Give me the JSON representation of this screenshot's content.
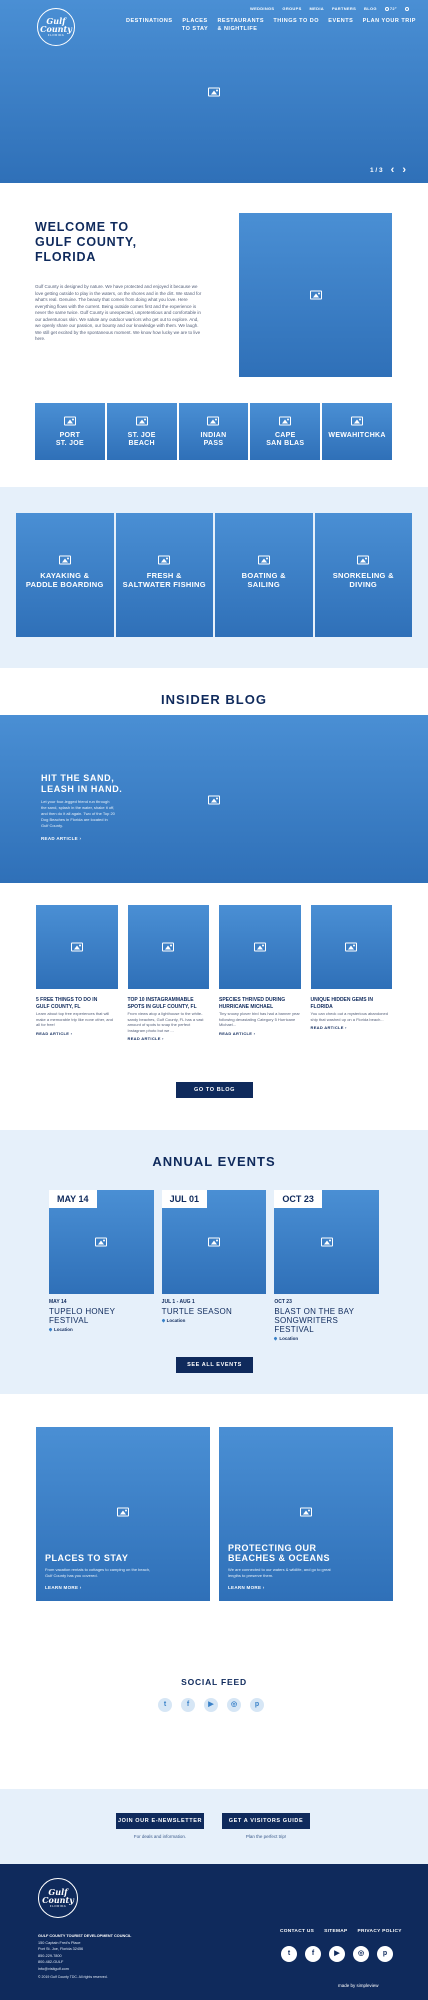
{
  "header": {
    "logo_line1": "Gulf",
    "logo_line2": "County",
    "logo_sub": "FLORIDA",
    "top_links": [
      "WEDDINGS",
      "GROUPS",
      "MEDIA",
      "PARTNERS",
      "BLOG"
    ],
    "weather": "72°",
    "nav": [
      {
        "line1": "DESTINATIONS",
        "line2": ""
      },
      {
        "line1": "PLACES",
        "line2": "TO STAY"
      },
      {
        "line1": "RESTAURANTS",
        "line2": "& NIGHTLIFE"
      },
      {
        "line1": "THINGS TO DO",
        "line2": ""
      },
      {
        "line1": "EVENTS",
        "line2": ""
      },
      {
        "line1": "PLAN YOUR TRIP",
        "line2": ""
      }
    ],
    "slide_counter": "1 / 3"
  },
  "welcome": {
    "title_line1": "WELCOME TO",
    "title_line2": "GULF COUNTY,",
    "title_line3": "FLORIDA",
    "body": "Gulf County is designed by nature. We have protected and enjoyed it because we love getting outside to play in the waters, on the shores and in the dirt. We stand for what's real. Genuine. The beauty that comes from doing what you love. Here everything flows with the current. Being outside comes first and the experience is never the same twice. Gulf County is unexpected, unpretentious and comfortable in our adventurous skin. We salute any outdoor warriors who get out to explore. And, we openly share our passion, our bounty and our knowledge with them. We laugh. We still get excited by the spontaneous moment. We know how lucky we are to live here."
  },
  "destinations": [
    {
      "line1": "PORT",
      "line2": "ST. JOE"
    },
    {
      "line1": "ST. JOE",
      "line2": "BEACH"
    },
    {
      "line1": "INDIAN",
      "line2": "PASS"
    },
    {
      "line1": "CAPE",
      "line2": "SAN BLAS"
    },
    {
      "line1": "WEWAHITCHKA",
      "line2": ""
    }
  ],
  "activities": [
    {
      "line1": "KAYAKING &",
      "line2": "PADDLE BOARDING"
    },
    {
      "line1": "FRESH &",
      "line2": "SALTWATER FISHING"
    },
    {
      "line1": "BOATING &",
      "line2": "SAILING"
    },
    {
      "line1": "SNORKELING &",
      "line2": "DIVING"
    }
  ],
  "blog": {
    "heading": "INSIDER BLOG",
    "feature": {
      "title_line1": "HIT THE SAND,",
      "title_line2": "LEASH IN HAND.",
      "body": "Let your four-legged friend run through the sand, splash in the water, shake it off, and then do it all again. Two of the Top 20 Dog Beaches in Florida are located in Gulf County.",
      "link": "READ ARTICLE ›"
    },
    "posts": [
      {
        "title_line1": "5 FREE THINGS TO DO IN",
        "title_line2": "GULF COUNTY, FL",
        "body": "Learn about top free experiences that will make a memorable trip like none other, and all for free!",
        "link": "READ ARTICLE ›"
      },
      {
        "title_line1": "TOP 10 INSTAGRAMMABLE",
        "title_line2": "SPOTS IN GULF COUNTY, FL",
        "body": "From views atop a lighthouse to the white-sandy beaches, Gulf County, FL has a vast amount of spots to snap the perfect Instagram photo but we ...",
        "link": "READ ARTICLE ›"
      },
      {
        "title_line1": "SPECIES THRIVED DURING",
        "title_line2": "HURRICANE MICHAEL",
        "body": "Tiny snowy plover bird has had a banner year following devastating Category 5 Hurricane Michael...",
        "link": "READ ARTICLE ›"
      },
      {
        "title_line1": "UNIQUE HIDDEN GEMS IN",
        "title_line2": "FLORIDA",
        "body": "You can check out a mysterious abandoned ship that washed up on a Florida beach...",
        "link": "READ ARTICLE ›"
      }
    ],
    "button": "GO TO BLOG"
  },
  "events": {
    "heading": "ANNUAL EVENTS",
    "items": [
      {
        "badge": "MAY 14",
        "date": "MAY 14",
        "name_line1": "TUPELO HONEY FESTIVAL",
        "name_line2": "",
        "location": "Location"
      },
      {
        "badge": "JUL 01",
        "date": "JUL 1 - AUG 1",
        "name_line1": "TURTLE SEASON",
        "name_line2": "",
        "location": "Location"
      },
      {
        "badge": "OCT 23",
        "date": "OCT 23",
        "name_line1": "BLAST ON THE BAY",
        "name_line2": "SONGWRITERS FESTIVAL",
        "location": "Location"
      }
    ],
    "button": "SEE ALL EVENTS"
  },
  "promos": [
    {
      "title_line1": "PLACES TO STAY",
      "title_line2": "",
      "body": "From vacation rentals to cottages to camping on the beach, Gulf County has you covered.",
      "link": "LEARN MORE ›"
    },
    {
      "title_line1": "PROTECTING OUR",
      "title_line2": "BEACHES & OCEANS",
      "body": "We are connected to our waters & wildlife, and go to great lengths to preserve them.",
      "link": "LEARN MORE ›"
    }
  ],
  "social": {
    "heading": "SOCIAL FEED",
    "icons": [
      "twitter-icon",
      "facebook-icon",
      "youtube-icon",
      "instagram-icon",
      "pinterest-icon"
    ]
  },
  "cta": {
    "newsletter_button": "JOIN OUR E-NEWSLETTER",
    "newsletter_caption": "For deals and information.",
    "guide_button": "GET A VISITORS GUIDE",
    "guide_caption": "Plan the perfect trip!"
  },
  "footer": {
    "org": "GULF COUNTY TOURIST DEVELOPMENT COUNCIL",
    "address1": "150 Captain Fred's Place",
    "address2": "Port St. Joe, Florida 32456",
    "phone1": "850-229-7800",
    "phone2": "800-482-GULF",
    "email": "info@visitgulf.com",
    "copyright": "© 2019 Gulf County TDC. All rights reserved.",
    "links": [
      "CONTACT US",
      "SITEMAP",
      "PRIVACY POLICY"
    ],
    "made_by": "made by simpleview"
  },
  "colors": {
    "primary_blue": "#3b82c8",
    "navy": "#0f2a5c",
    "light_bg": "#e6f0fa"
  }
}
